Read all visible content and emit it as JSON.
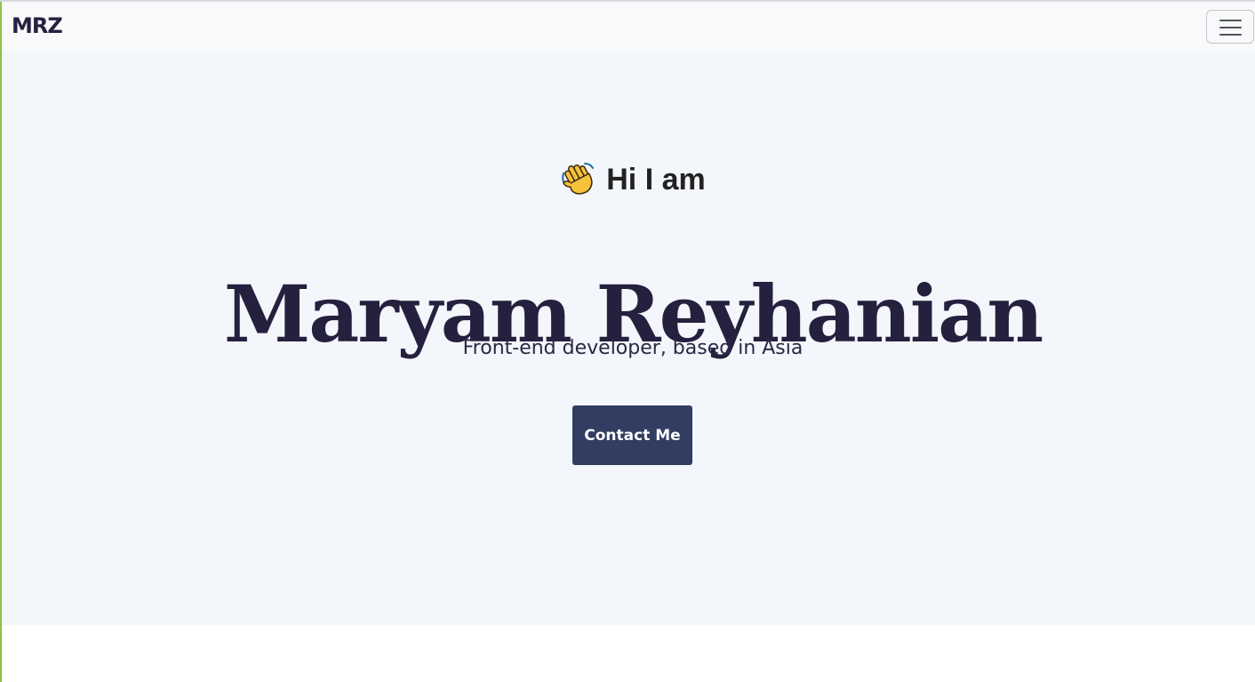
{
  "colors": {
    "accent_left_edge": "#8bc34a",
    "brand_text": "#25213f",
    "hero_background": "#f3f6fa",
    "name_text": "#26203f",
    "tagline_text": "#2b2745",
    "button_background": "#323d62"
  },
  "navbar": {
    "brand": "MRZ",
    "toggler_icon": "hamburger-menu-icon"
  },
  "hero": {
    "greeting_icon": "waving-hand-icon",
    "greeting": "Hi I am",
    "name": "Maryam Reyhanian",
    "tagline": "Front-end developer, based in Asia",
    "contact_button": "Contact Me"
  }
}
